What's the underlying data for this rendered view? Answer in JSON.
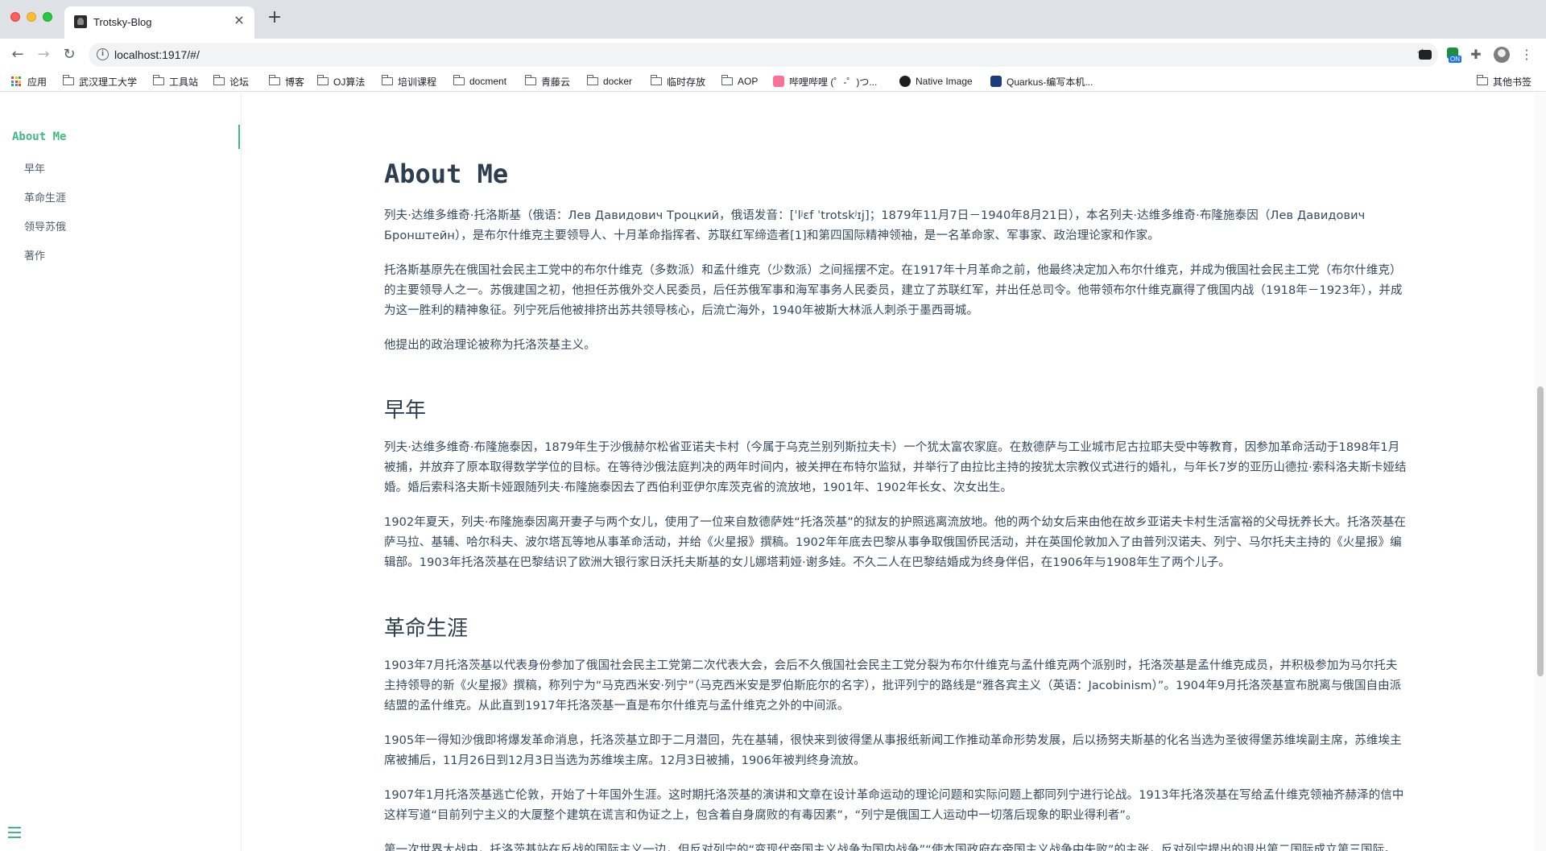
{
  "browser": {
    "tab_title": "Trotsky-Blog",
    "tab_close": "×",
    "new_tab": "+",
    "url": "localhost:1917/#/",
    "ext_badge": "ON"
  },
  "bookmarks": {
    "apps": "应用",
    "items": [
      "武汉理工大学",
      "工具站",
      "论坛",
      "博客",
      "OJ算法",
      "培训课程",
      "docment",
      "青藤云",
      "docker",
      "临时存放",
      "AOP",
      "哔哩哔哩 (゜-゜)つ...",
      "Native Image",
      "Quarkus-编写本机..."
    ],
    "other": "其他书签"
  },
  "sidebar": {
    "active": "About Me",
    "items": [
      "早年",
      "革命生涯",
      "领导苏俄",
      "著作"
    ]
  },
  "content": {
    "title": "About Me",
    "intro_p1": "列夫·达维多维奇·托洛斯基（俄语：Лев Давидович Троцкий，俄语发音：[ˈlʲɛf ˈtrotskʲɪj]；1879年11月7日－1940年8月21日），本名列夫·达维多维奇·布隆施泰因（Лев Давидович Бронштейн），是布尔什维克主要领导人、十月革命指挥者、苏联红军缔造者[1]和第四国际精神领袖，是一名革命家、军事家、政治理论家和作家。",
    "intro_p2": "托洛斯基原先在俄国社会民主工党中的布尔什维克（多数派）和孟什维克（少数派）之间摇摆不定。在1917年十月革命之前，他最终决定加入布尔什维克，并成为俄国社会民主工党（布尔什维克）的主要领导人之一。苏俄建国之初，他担任苏俄外交人民委员，后任苏俄军事和海军事务人民委员，建立了苏联红军，并出任总司令。他带领布尔什维克赢得了俄国内战（1918年－1923年），并成为这一胜利的精神象征。列宁死后他被排挤出苏共领导核心，后流亡海外，1940年被斯大林派人刺杀于墨西哥城。",
    "intro_p3": "他提出的政治理论被称为托洛茨基主义。",
    "early_title": "早年",
    "early_p1": "列夫·达维多维奇·布隆施泰因，1879年生于沙俄赫尔松省亚诺夫卡村（今属于乌克兰别列斯拉夫卡）一个犹太富农家庭。在敖德萨与工业城市尼古拉耶夫受中等教育，因参加革命活动于1898年1月被捕，并放弃了原本取得数学学位的目标。在等待沙俄法庭判决的两年时间内，被关押在布特尔监狱，并举行了由拉比主持的按犹太宗教仪式进行的婚礼，与年长7岁的亚历山德拉·索科洛夫斯卡娅结婚。婚后索科洛夫斯卡娅跟随列夫·布隆施泰因去了西伯利亚伊尔库茨克省的流放地，1901年、1902年长女、次女出生。",
    "early_p2": "1902年夏天，列夫·布隆施泰因离开妻子与两个女儿，使用了一位来自敖德萨姓“托洛茨基”的狱友的护照逃离流放地。他的两个幼女后来由他在故乡亚诺夫卡村生活富裕的父母抚养长大。托洛茨基在萨马拉、基辅、哈尔科夫、波尔塔瓦等地从事革命活动，并给《火星报》撰稿。1902年年底去巴黎从事争取俄国侨民活动，并在英国伦敦加入了由普列汉诺夫、列宁、马尔托夫主持的《火星报》编辑部。1903年托洛茨基在巴黎结识了欧洲大银行家日沃托夫斯基的女儿娜塔莉娅·谢多娃。不久二人在巴黎结婚成为终身伴侣，在1906年与1908年生了两个儿子。",
    "career_title": "革命生涯",
    "career_p1": "1903年7月托洛茨基以代表身份参加了俄国社会民主工党第二次代表大会，会后不久俄国社会民主工党分裂为布尔什维克与孟什维克两个派别时，托洛茨基是孟什维克成员，并积极参加为马尔托夫主持领导的新《火星报》撰稿，称列宁为“马克西米安·列宁”（马克西米安是罗伯斯庇尔的名字），批评列宁的路线是“雅各宾主义（英语：Jacobinism）”。1904年9月托洛茨基宣布脱离与俄国自由派结盟的孟什维克。从此直到1917年托洛茨基一直是布尔什维克与孟什维克之外的中间派。",
    "career_p2": "1905年一得知沙俄即将爆发革命消息，托洛茨基立即于二月潜回，先在基辅，很快来到彼得堡从事报纸新闻工作推动革命形势发展，后以扬努夫斯基的化名当选为圣彼得堡苏维埃副主席，苏维埃主席被捕后，11月26日到12月3日当选为苏维埃主席。12月3日被捕，1906年被判终身流放。",
    "career_p3": "1907年1月托洛茨基逃亡伦敦，开始了十年国外生涯。这时期托洛茨基的演讲和文章在设计革命运动的理论问题和实际问题上都同列宁进行论战。1913年托洛茨基在写给孟什维克领袖齐赫泽的信中这样写道“目前列宁主义的大厦整个建筑在谎言和伪证之上，包含着自身腐败的有毒因素”，“列宁是俄国工人运动中一切落后现象的职业得利者”。",
    "career_p4": "第一次世界大战中，托洛茨基站在反战的国际主义一边，但反对列宁的“变现代帝国主义战争为国内战争”“使本国政府在帝国主义战争中失败”的主张，反对列宁提出的退出第二国际成立第三国际。"
  },
  "colors": {
    "accent": "#42b983",
    "heading": "#2c3e50",
    "text": "#34495e"
  },
  "icons": [
    "back-icon",
    "forward-icon",
    "reload-icon",
    "info-icon",
    "star-icon",
    "extensions-icon",
    "menu-icon",
    "folder-icon",
    "hamburger-icon"
  ]
}
